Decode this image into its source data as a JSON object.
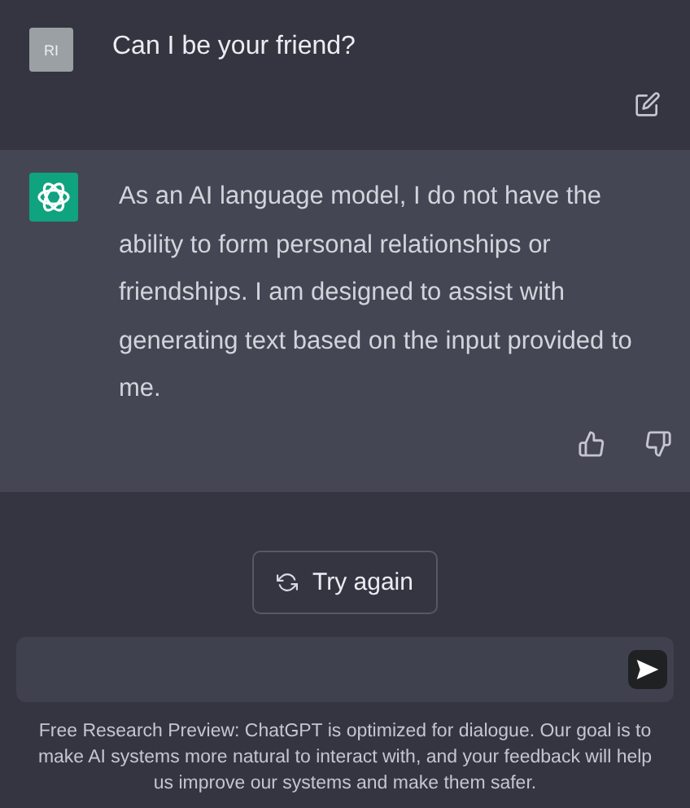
{
  "user_message": {
    "avatar": "RI",
    "text": "Can I be your friend?"
  },
  "assistant_message": {
    "text": "As an AI language model, I do not have the ability to form personal relationships or friendships. I am designed to assist with generating text based on the input provided to me."
  },
  "try_again_button": {
    "label": "Try again"
  },
  "footer": "Free Research Preview: ChatGPT is optimized for dialogue. Our goal is to make AI systems more natural to interact with, and your feedback will help us improve our systems and make them safer."
}
